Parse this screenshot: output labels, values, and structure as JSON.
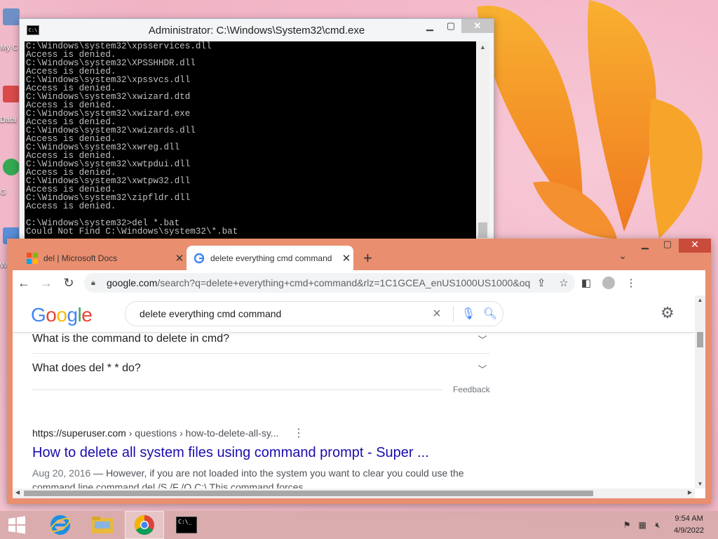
{
  "desktop": {
    "icons": [
      {
        "label": "My C"
      },
      {
        "label": "Data"
      },
      {
        "label": "G"
      },
      {
        "label": "W"
      }
    ]
  },
  "cmd": {
    "title": "Administrator: C:\\Windows\\System32\\cmd.exe",
    "output": "C:\\Windows\\system32\\xpsservices.dll\nAccess is denied.\nC:\\Windows\\system32\\XPSSHHDR.dll\nAccess is denied.\nC:\\Windows\\system32\\xpssvcs.dll\nAccess is denied.\nC:\\Windows\\system32\\xwizard.dtd\nAccess is denied.\nC:\\Windows\\system32\\xwizard.exe\nAccess is denied.\nC:\\Windows\\system32\\xwizards.dll\nAccess is denied.\nC:\\Windows\\system32\\xwreg.dll\nAccess is denied.\nC:\\Windows\\system32\\xwtpdui.dll\nAccess is denied.\nC:\\Windows\\system32\\xwtpw32.dll\nAccess is denied.\nC:\\Windows\\system32\\zipfldr.dll\nAccess is denied.\n\nC:\\Windows\\system32>del *.bat\nCould Not Find C:\\Windows\\system32\\*.bat",
    "buttons": {
      "minimize": "▁",
      "maximize": "▢",
      "close": "✕"
    }
  },
  "chrome": {
    "tabs": [
      {
        "title": "del | Microsoft Docs",
        "active": false
      },
      {
        "title": "delete everything cmd command",
        "active": true
      }
    ],
    "new_tab": "+",
    "url_host": "google.com",
    "url_rest": "/search?q=delete+everything+cmd+command&rlz=1C1GCEA_enUS1000US1000&oq=delete+...",
    "search": {
      "logo": "Google",
      "query": "delete everything cmd command"
    },
    "people_also_ask": [
      {
        "question": "What is the command to delete in cmd?"
      },
      {
        "question": "What does del * * do?"
      }
    ],
    "feedback": "Feedback",
    "result": {
      "site": "https://superuser.com",
      "path": " › questions › how-to-delete-all-sy...",
      "title": "How to delete all system files using command prompt - Super ...",
      "date": "Aug 20, 2016",
      "snippet": " — However, if you are not loaded into the system you want to clear you could use the command line command del /S /F /Q C:\\ This command forces"
    }
  },
  "taskbar": {
    "time": "9:54 AM",
    "date": "4/9/2022"
  },
  "colors": {
    "chrome_frame": "#e98e6f",
    "link": "#1a0dab",
    "google_blue": "#4285f4",
    "google_red": "#ea4335",
    "google_yellow": "#fbbc05",
    "google_green": "#34a853"
  }
}
